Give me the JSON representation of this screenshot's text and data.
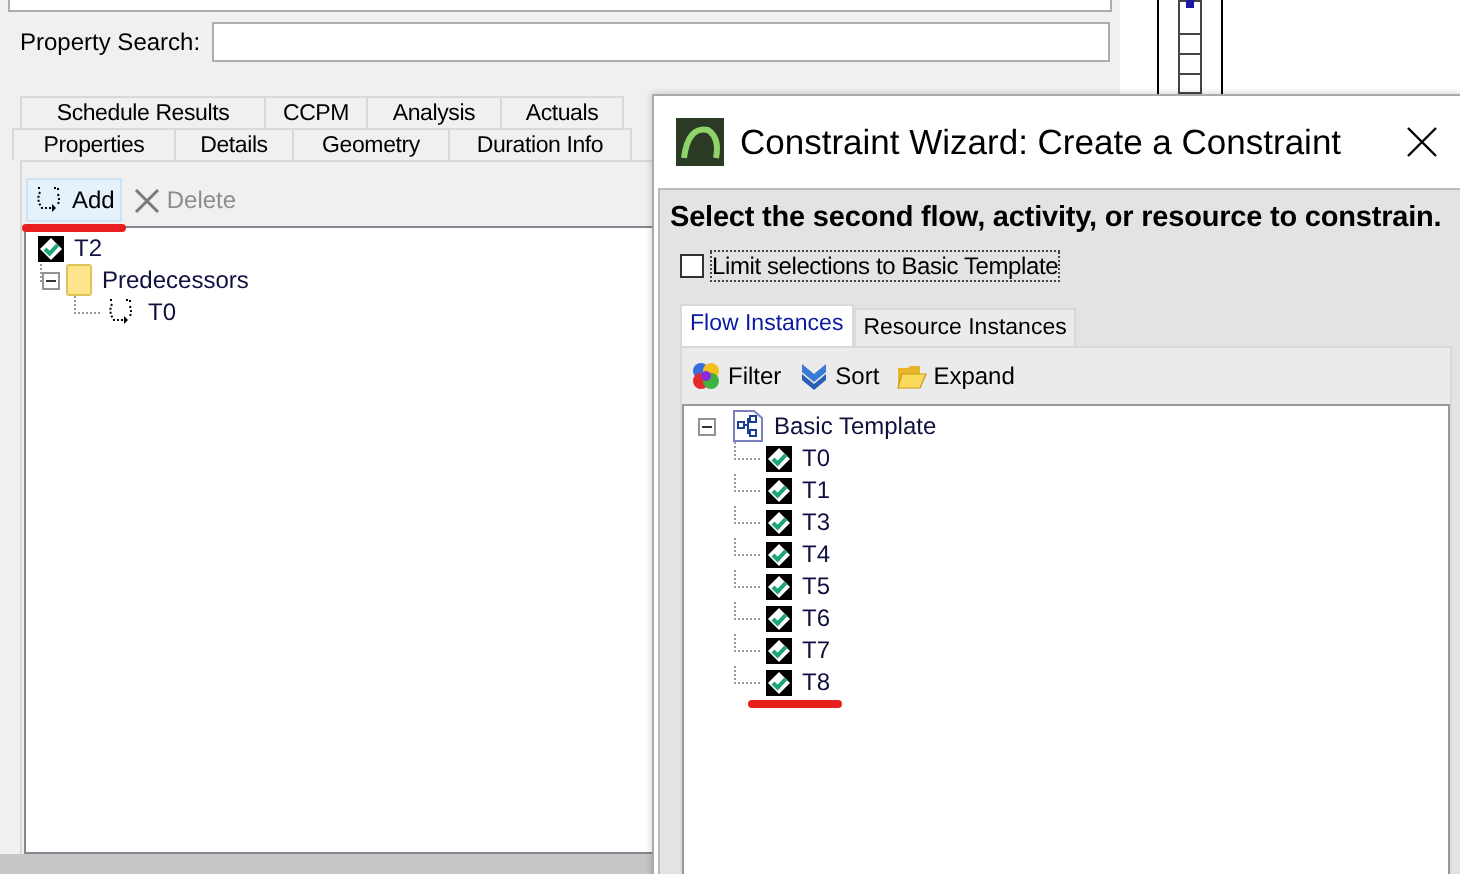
{
  "property_search": {
    "label": "Property Search:"
  },
  "tabs_row_1": [
    {
      "label": "Schedule Results",
      "selected": false
    },
    {
      "label": "CCPM",
      "selected": false
    },
    {
      "label": "Analysis",
      "selected": false
    },
    {
      "label": "Actuals",
      "selected": false
    }
  ],
  "tabs_row_2": [
    {
      "label": "Properties",
      "selected": false
    },
    {
      "label": "Details",
      "selected": false
    },
    {
      "label": "Geometry",
      "selected": false
    },
    {
      "label": "Duration Info",
      "selected": false
    }
  ],
  "toolbar": [
    {
      "label": "Add",
      "kind": "add",
      "disabled": false,
      "hovered": true,
      "underlined": true
    },
    {
      "label": "Delete",
      "kind": "delete",
      "disabled": true,
      "hovered": false,
      "underlined": false
    }
  ],
  "tree": [
    {
      "label": "T2",
      "kind": "task",
      "underlined": false,
      "children": [
        {
          "label": "Predecessors",
          "kind": "folder",
          "expanded": true,
          "underlined": false,
          "children": [
            {
              "label": "T0",
              "kind": "link",
              "underlined": false
            }
          ]
        }
      ]
    }
  ],
  "dialog": {
    "title": "Constraint Wizard: Create a Constraint",
    "heading": "Select the second flow, activity, or resource to constrain.",
    "checkbox": {
      "label": "Limit selections to Basic Template",
      "checked": false
    },
    "tabs": [
      {
        "label": "Flow Instances",
        "selected": true
      },
      {
        "label": "Resource Instances",
        "selected": false
      }
    ],
    "toolbar": [
      {
        "label": "Filter",
        "kind": "filter"
      },
      {
        "label": "Sort",
        "kind": "sort"
      },
      {
        "label": "Expand",
        "kind": "expand"
      }
    ],
    "tree": [
      {
        "label": "Basic Template",
        "kind": "template",
        "expanded": true,
        "underlined": false,
        "children": [
          {
            "label": "T0",
            "kind": "task",
            "underlined": false
          },
          {
            "label": "T1",
            "kind": "task",
            "underlined": false
          },
          {
            "label": "T3",
            "kind": "task",
            "underlined": false
          },
          {
            "label": "T4",
            "kind": "task",
            "underlined": false
          },
          {
            "label": "T5",
            "kind": "task",
            "underlined": false
          },
          {
            "label": "T6",
            "kind": "task",
            "underlined": false
          },
          {
            "label": "T7",
            "kind": "task",
            "underlined": false
          },
          {
            "label": "T8",
            "kind": "task",
            "underlined": true
          }
        ]
      }
    ]
  }
}
